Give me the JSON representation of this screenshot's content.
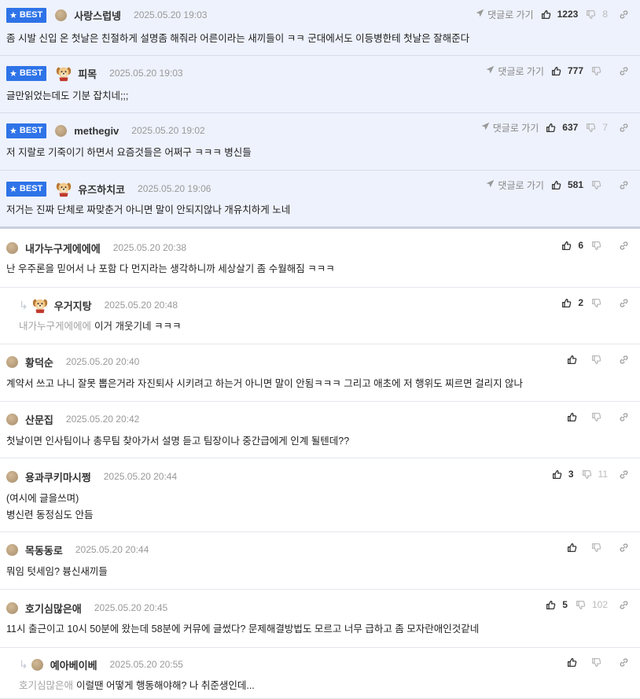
{
  "labels": {
    "best": "BEST",
    "goto_reply": "댓글로 가기"
  },
  "colors": {
    "best_bg": "#eef2fc",
    "badge": "#2e73e8"
  },
  "comments": [
    {
      "best": true,
      "avatar": "dot",
      "nick": "사랑스럽넹",
      "date": "2025.05.20 19:03",
      "up": "1223",
      "down": "8",
      "lines": [
        "좀 시발 신입 온 첫날은 친절하게 설명좀 해줘라 어른이라는 새끼들이 ㅋㅋ 군대에서도 이등병한테 첫날은 잘해준다"
      ]
    },
    {
      "best": true,
      "avatar": "dog",
      "nick": "피목",
      "date": "2025.05.20 19:03",
      "up": "777",
      "down": "",
      "lines": [
        "글만읽었는데도 기분 잡치네;;;"
      ]
    },
    {
      "best": true,
      "avatar": "dot",
      "nick": "methegiv",
      "date": "2025.05.20 19:02",
      "up": "637",
      "down": "7",
      "lines": [
        "저 지랄로 기죽이기 하면서 요즘것들은 어쩌구 ㅋㅋㅋ 병신들"
      ]
    },
    {
      "best": true,
      "avatar": "dog",
      "nick": "유즈하치코",
      "date": "2025.05.20 19:06",
      "up": "581",
      "down": "",
      "lines": [
        "저거는 진짜 단체로 짜맞춘거 아니면 말이 안되지않나 개유치하게 노네"
      ]
    },
    {
      "best": false,
      "avatar": "dot",
      "nick": "내가누구게에에에",
      "date": "2025.05.20 20:38",
      "up": "6",
      "down": "",
      "lines": [
        "난 우주론을 믿어서 나 포함 다 먼지라는 생각하니까 세상살기 좀 수월해짐 ㅋㅋㅋ"
      ]
    },
    {
      "best": false,
      "reply": true,
      "avatar": "dog",
      "nick": "우거지탕",
      "date": "2025.05.20 20:48",
      "up": "2",
      "down": "",
      "mention": "내가누구게에에에",
      "lines": [
        "이거 개웃기네 ㅋㅋㅋ"
      ]
    },
    {
      "best": false,
      "avatar": "dot",
      "nick": "황덕순",
      "date": "2025.05.20 20:40",
      "up": "",
      "down": "",
      "lines": [
        "계약서 쓰고 나니 잘못 뽑은거라 자진퇴사 시키려고 하는거 아니면 말이 안됨ㅋㅋㅋ 그리고 애초에 저 행위도 찌르면 걸리지 않나"
      ]
    },
    {
      "best": false,
      "avatar": "dot",
      "nick": "산문집",
      "date": "2025.05.20 20:42",
      "up": "",
      "down": "",
      "lines": [
        "첫날이면 인사팀이나 총무팀 찾아가서 설명 듣고 팀장이나 중간급에게 인계 될텐데??"
      ]
    },
    {
      "best": false,
      "avatar": "dot",
      "nick": "용과쿠키마시쩡",
      "date": "2025.05.20 20:44",
      "up": "3",
      "down": "11",
      "lines": [
        "(여시에 글을쓰며)",
        "병신련 동정심도 안듬"
      ]
    },
    {
      "best": false,
      "avatar": "dot",
      "nick": "목동동로",
      "date": "2025.05.20 20:44",
      "up": "",
      "down": "",
      "lines": [
        "뭐임 텃세임? 븅신새끼들"
      ]
    },
    {
      "best": false,
      "avatar": "dot",
      "nick": "호기심많은애",
      "date": "2025.05.20 20:45",
      "up": "5",
      "down": "102",
      "lines": [
        "11시 출근이고 10시 50분에 왔는데 58분에 커뮤에 글썼다? 문제해결방법도 모르고 너무 급하고 좀 모자란애인것같네"
      ]
    },
    {
      "best": false,
      "reply": true,
      "avatar": "dot",
      "nick": "예아베이베",
      "date": "2025.05.20 20:55",
      "up": "",
      "down": "",
      "mention": "호기심많은애",
      "lines": [
        "이럴땐 어떻게 행동해야해? 나 취준생인데..."
      ]
    }
  ]
}
